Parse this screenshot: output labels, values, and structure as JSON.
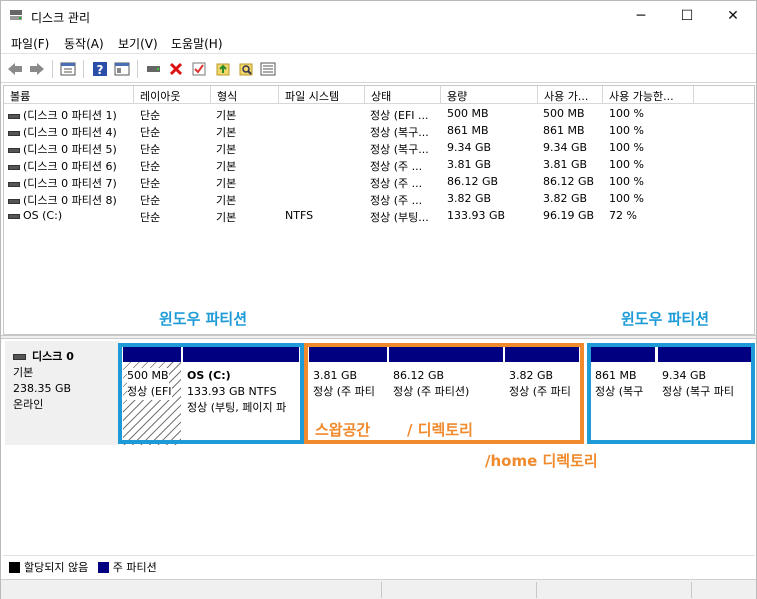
{
  "window": {
    "title": "디스크 관리",
    "minimize": "─",
    "maximize": "☐",
    "close": "✕"
  },
  "menu": [
    {
      "label": "파일(F)"
    },
    {
      "label": "동작(A)"
    },
    {
      "label": "보기(V)"
    },
    {
      "label": "도움말(H)"
    }
  ],
  "toolbar": [
    "back-icon",
    "forward-icon",
    "properties-icon",
    "help-icon",
    "view-icon",
    "connect-drive-icon",
    "delete-icon",
    "check-icon",
    "up-icon",
    "search-icon",
    "details-icon"
  ],
  "volume_columns": [
    "볼륨",
    "레이아웃",
    "형식",
    "파일 시스템",
    "상태",
    "용량",
    "사용 가...",
    "사용 가능한..."
  ],
  "volumes": [
    {
      "name": "(디스크 0 파티션 1)",
      "layout": "단순",
      "type": "기본",
      "fs": "",
      "status": "정상 (EFI ...",
      "capacity": "500 MB",
      "free": "500 MB",
      "pct": "100 %"
    },
    {
      "name": "(디스크 0 파티션 4)",
      "layout": "단순",
      "type": "기본",
      "fs": "",
      "status": "정상 (복구...",
      "capacity": "861 MB",
      "free": "861 MB",
      "pct": "100 %"
    },
    {
      "name": "(디스크 0 파티션 5)",
      "layout": "단순",
      "type": "기본",
      "fs": "",
      "status": "정상 (복구...",
      "capacity": "9.34 GB",
      "free": "9.34 GB",
      "pct": "100 %"
    },
    {
      "name": "(디스크 0 파티션 6)",
      "layout": "단순",
      "type": "기본",
      "fs": "",
      "status": "정상 (주 ...",
      "capacity": "3.81 GB",
      "free": "3.81 GB",
      "pct": "100 %"
    },
    {
      "name": "(디스크 0 파티션 7)",
      "layout": "단순",
      "type": "기본",
      "fs": "",
      "status": "정상 (주 ...",
      "capacity": "86.12 GB",
      "free": "86.12 GB",
      "pct": "100 %"
    },
    {
      "name": "(디스크 0 파티션 8)",
      "layout": "단순",
      "type": "기본",
      "fs": "",
      "status": "정상 (주 ...",
      "capacity": "3.82 GB",
      "free": "3.82 GB",
      "pct": "100 %"
    },
    {
      "name": "OS (C:)",
      "layout": "단순",
      "type": "기본",
      "fs": "NTFS",
      "status": "정상 (부팅...",
      "capacity": "133.93 GB",
      "free": "96.19 GB",
      "pct": "72 %"
    }
  ],
  "disk": {
    "name": "디스크 0",
    "type": "기본",
    "size": "238.35 GB",
    "state": "온라인"
  },
  "partitions": [
    {
      "line1": "500 MB",
      "line2": "정상 (EFI",
      "hatched": true
    },
    {
      "title": "OS  (C:)",
      "line1": "133.93 GB NTFS",
      "line2": "정상 (부팅, 페이지 파"
    },
    {
      "line1": "3.81 GB",
      "line2": "정상 (주 파티"
    },
    {
      "line1": "86.12 GB",
      "line2": "정상 (주 파티션)"
    },
    {
      "line1": "3.82 GB",
      "line2": "정상 (주 파티"
    },
    {
      "line1": "861 MB",
      "line2": "정상 (복구"
    },
    {
      "line1": "9.34 GB",
      "line2": "정상 (복구 파티"
    }
  ],
  "annotations": {
    "win_left": "윈도우 파티션",
    "win_right": "윈도우 파티션",
    "swap": "스왑공간",
    "root": "/ 디렉토리",
    "home": "/home 디렉토리",
    "blue": "#1e9bd7",
    "orange": "#f08a2c"
  },
  "legend": {
    "unallocated": "할당되지 않음",
    "primary": "주 파티션"
  }
}
